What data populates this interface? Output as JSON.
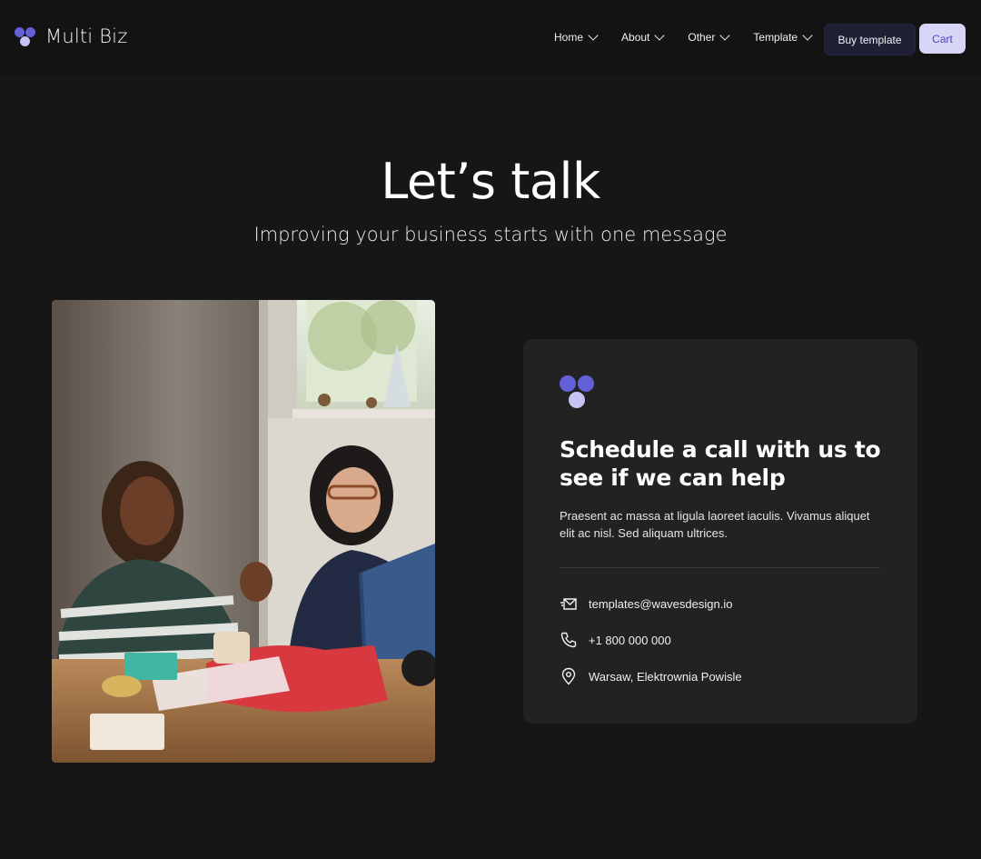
{
  "brand": {
    "name": "Multi Biz"
  },
  "nav": {
    "items": [
      {
        "label": "Home"
      },
      {
        "label": "About"
      },
      {
        "label": "Other"
      },
      {
        "label": "Template"
      }
    ],
    "buy_label": "Buy template",
    "cart_label": "Cart"
  },
  "hero": {
    "title": "Let’s talk",
    "subtitle": "Improving your business starts with one message"
  },
  "card": {
    "title": "Schedule a call with us to see if we can help",
    "text": "Praesent ac massa at ligula laoreet iaculis. Vivamus aliquet elit ac nisl. Sed aliquam ultrices.",
    "email": "templates@wavesdesign.io",
    "phone": "+1 800 000 000",
    "address": "Warsaw, Elektrownia Powisle"
  },
  "colors": {
    "accent": "#6460d8",
    "accent_light": "#c6c3f3",
    "background": "#161616",
    "card": "#222222",
    "buy_button": "#1f1f36",
    "cart_button": "#d8d6f6"
  }
}
